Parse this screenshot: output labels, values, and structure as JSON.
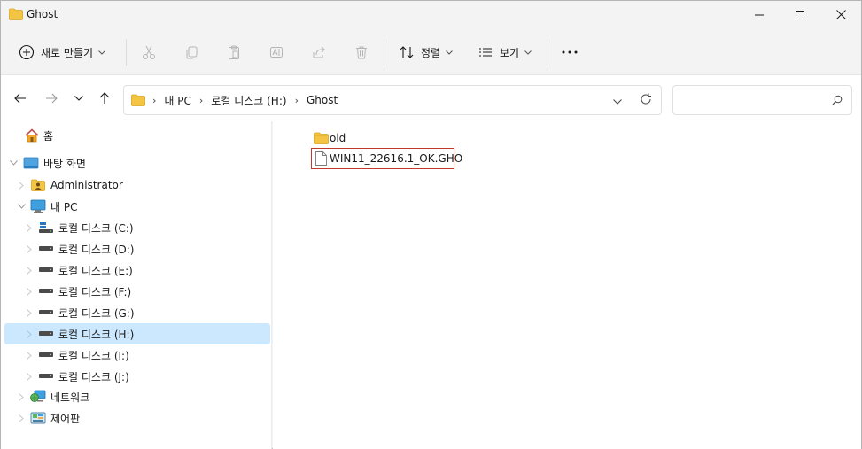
{
  "window": {
    "title": "Ghost",
    "controls": [
      "minimize",
      "maximize",
      "close"
    ]
  },
  "commandbar": {
    "new_label": "새로 만들기",
    "sort_label": "정렬",
    "view_label": "보기",
    "more_glyph": "•••",
    "disabled_actions": [
      "cut",
      "copy",
      "paste",
      "rename",
      "share",
      "delete"
    ]
  },
  "address": {
    "crumbs": [
      "내 PC",
      "로컬 디스크 (H:)",
      "Ghost"
    ],
    "separator": "›"
  },
  "search": {
    "value": "",
    "placeholder": ""
  },
  "nav": {
    "items": [
      {
        "label": "홈",
        "icon": "home-icon",
        "level": 0,
        "expander": "none"
      },
      {
        "label": "바탕 화면",
        "icon": "desktop-icon",
        "level": 0,
        "expander": "expanded"
      },
      {
        "label": "Administrator",
        "icon": "user-folder-icon",
        "level": 1,
        "expander": "collapsed"
      },
      {
        "label": "내 PC",
        "icon": "pc-icon",
        "level": 1,
        "expander": "expanded"
      },
      {
        "label": "로컬 디스크 (C:)",
        "icon": "system-drive-icon",
        "level": 2,
        "expander": "collapsed"
      },
      {
        "label": "로컬 디스크 (D:)",
        "icon": "drive-icon",
        "level": 2,
        "expander": "collapsed"
      },
      {
        "label": "로컬 디스크 (E:)",
        "icon": "drive-icon",
        "level": 2,
        "expander": "collapsed"
      },
      {
        "label": "로컬 디스크 (F:)",
        "icon": "drive-icon",
        "level": 2,
        "expander": "collapsed"
      },
      {
        "label": "로컬 디스크 (G:)",
        "icon": "drive-icon",
        "level": 2,
        "expander": "collapsed"
      },
      {
        "label": "로컬 디스크 (H:)",
        "icon": "drive-icon",
        "level": 2,
        "expander": "collapsed",
        "selected": true
      },
      {
        "label": "로컬 디스크 (I:)",
        "icon": "drive-icon",
        "level": 2,
        "expander": "collapsed"
      },
      {
        "label": "로컬 디스크 (J:)",
        "icon": "drive-icon",
        "level": 2,
        "expander": "collapsed"
      },
      {
        "label": "네트워크",
        "icon": "network-icon",
        "level": 1,
        "expander": "collapsed"
      },
      {
        "label": "제어판",
        "icon": "control-panel-icon",
        "level": 1,
        "expander": "collapsed"
      }
    ]
  },
  "content": {
    "files": [
      {
        "name": "old",
        "icon": "folder-icon",
        "highlighted": false
      },
      {
        "name": "WIN11_22616.1_OK.GHO",
        "icon": "file-icon",
        "highlighted": true
      }
    ]
  },
  "colors": {
    "accent": "#cce8ff",
    "folder": "#f4c542",
    "highlight_border": "#c0392b",
    "chrome": "#f3f3f3"
  }
}
